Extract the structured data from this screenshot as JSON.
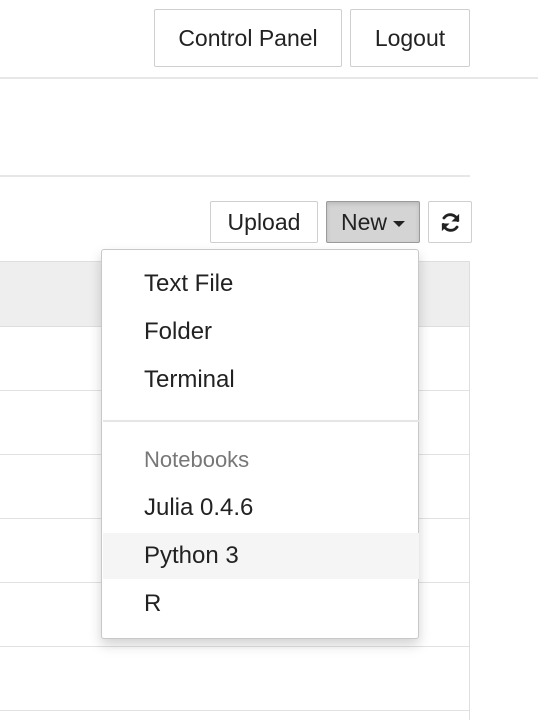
{
  "header": {
    "control_panel_label": "Control Panel",
    "logout_label": "Logout"
  },
  "toolbar": {
    "upload_label": "Upload",
    "new_label": "New",
    "refresh_icon": "refresh-icon"
  },
  "new_menu": {
    "items": [
      {
        "label": "Text File"
      },
      {
        "label": "Folder"
      },
      {
        "label": "Terminal"
      }
    ],
    "notebooks_header": "Notebooks",
    "notebooks": [
      {
        "label": "Julia 0.4.6"
      },
      {
        "label": "Python 3",
        "highlighted": true
      },
      {
        "label": "R"
      }
    ]
  }
}
